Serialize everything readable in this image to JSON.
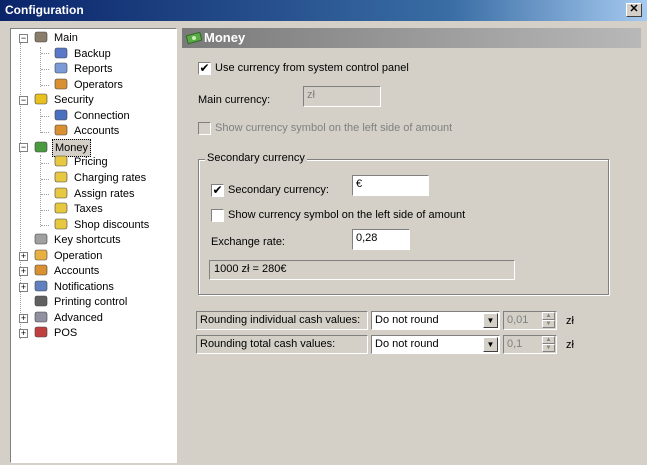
{
  "window": {
    "title": "Configuration",
    "close_glyph": "✕"
  },
  "tree": {
    "items": [
      {
        "label": "Main",
        "icon": "house-icon",
        "color": "#8a7d6a"
      },
      {
        "label": "Backup",
        "icon": "disk-icon",
        "color": "#5a78c8"
      },
      {
        "label": "Reports",
        "icon": "report-icon",
        "color": "#7a9ad8"
      },
      {
        "label": "Operators",
        "icon": "operators-icon",
        "color": "#d89030"
      },
      {
        "label": "Security",
        "icon": "shield-icon",
        "color": "#e8c020"
      },
      {
        "label": "Connection",
        "icon": "connection-icon",
        "color": "#4a70c0"
      },
      {
        "label": "Accounts",
        "icon": "accounts-icon",
        "color": "#d89030"
      },
      {
        "label": "Money",
        "icon": "money-icon",
        "color": "#4a9a40"
      },
      {
        "label": "Pricing",
        "icon": "folder-icon",
        "color": "#e8c840"
      },
      {
        "label": "Charging rates",
        "icon": "folder-icon",
        "color": "#e8c840"
      },
      {
        "label": "Assign rates",
        "icon": "assign-icon",
        "color": "#e8c840"
      },
      {
        "label": "Taxes",
        "icon": "folder-icon",
        "color": "#e8c840"
      },
      {
        "label": "Shop discounts",
        "icon": "folder-icon",
        "color": "#e8c840"
      },
      {
        "label": "Key shortcuts",
        "icon": "keyboard-icon",
        "color": "#a0a0a0"
      },
      {
        "label": "Operation",
        "icon": "operation-icon",
        "color": "#e8b040"
      },
      {
        "label": "Accounts",
        "icon": "accounts-icon",
        "color": "#d89030"
      },
      {
        "label": "Notifications",
        "icon": "chat-icon",
        "color": "#6080c0"
      },
      {
        "label": "Printing control",
        "icon": "printer-icon",
        "color": "#606060"
      },
      {
        "label": "Advanced",
        "icon": "advanced-icon",
        "color": "#9090a0"
      },
      {
        "label": "POS",
        "icon": "pos-icon",
        "color": "#c04040"
      }
    ]
  },
  "header": {
    "title": "Money"
  },
  "money": {
    "use_system_currency": {
      "label": "Use currency from system control panel",
      "checked": "✔"
    },
    "main_currency": {
      "label": "Main currency:",
      "value": "zł"
    },
    "show_symbol_left_main": {
      "label": "Show currency symbol on the left side of amount"
    },
    "secondary": {
      "group_title": "Secondary currency",
      "enabled": {
        "label": "Secondary currency:",
        "checked": "✔"
      },
      "value": "€",
      "show_symbol_left": {
        "label": "Show currency symbol on the left side of amount"
      },
      "exchange_rate_label": "Exchange rate:",
      "exchange_rate": "0,28",
      "example": "1000 zł = 280€"
    },
    "rounding_individual": {
      "label": "Rounding individual cash values:",
      "value": "Do not round",
      "precision": "0,01",
      "unit": "zł"
    },
    "rounding_total": {
      "label": "Rounding total cash values:",
      "value": "Do not round",
      "precision": "0,1",
      "unit": "zł"
    }
  },
  "glyphs": {
    "dropdown": "▼",
    "up": "▲",
    "down": "▼",
    "plus": "+",
    "minus": "−"
  }
}
